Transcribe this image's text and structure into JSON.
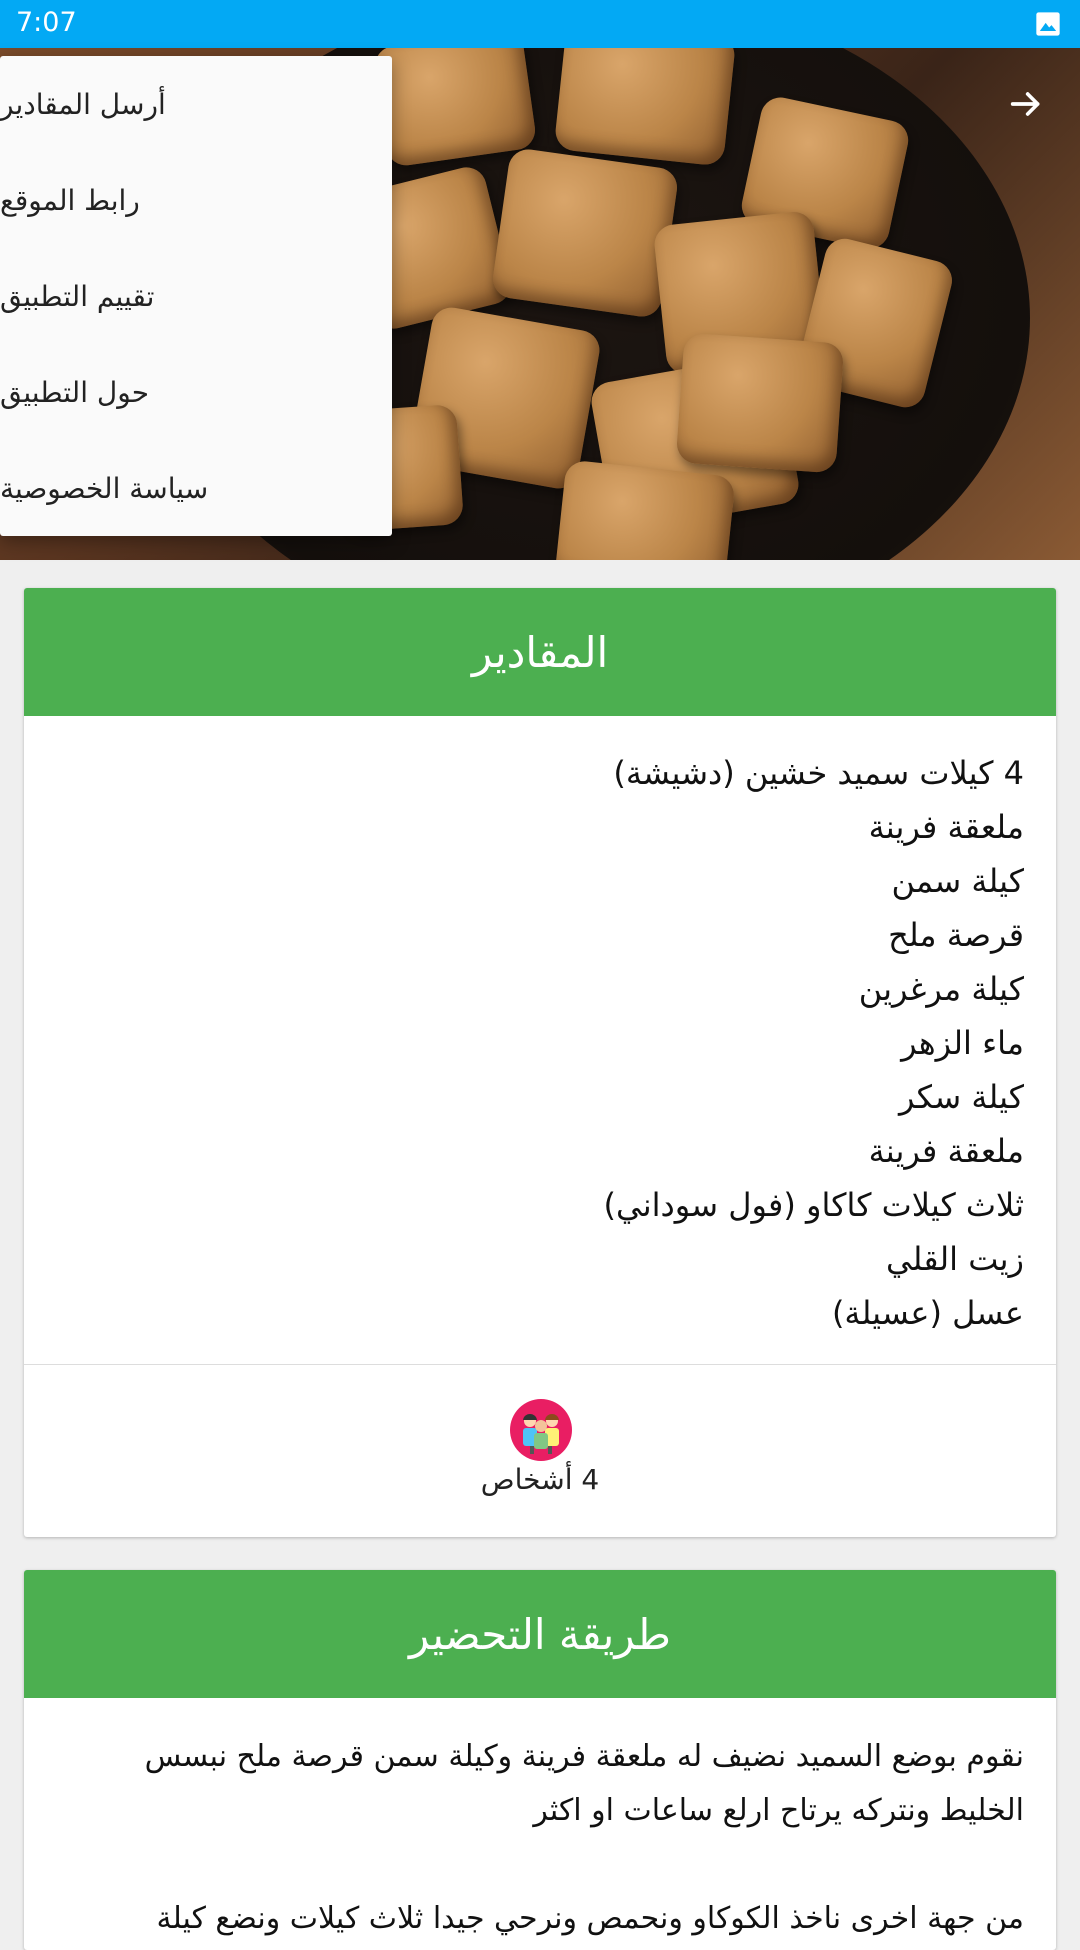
{
  "status_bar": {
    "time": "7:07"
  },
  "menu": {
    "items": [
      "أرسل المقادير",
      "رابط الموقع",
      "تقييم التطبيق",
      "حول التطبيق",
      "سياسة الخصوصية"
    ]
  },
  "ingredients": {
    "title": "المقادير",
    "items": [
      "4 كيلات سميد خشين (دشيشة)",
      "ملعقة فرينة",
      "كيلة سمن",
      "قرصة ملح",
      "كيلة مرغرين",
      "ماء الزهر",
      "كيلة سكر",
      "ملعقة فرينة",
      "ثلاث كيلات كاكاو (فول سوداني)",
      "زيت القلي",
      "عسل (عسيلة)"
    ],
    "servings": "4 أشخاص"
  },
  "method": {
    "title": "طريقة التحضير",
    "paragraphs": [
      "نقوم بوضع السميد نضيف له ملعقة فرينة وكيلة سمن قرصة ملح نبسس الخليط ونتركه يرتاح ارلع ساعات او اكثر",
      "من جهة اخرى ناخذ الكوكاو ونحمص ونرحي جيدا ثلاث كيلات ونضع كيلة"
    ]
  },
  "icons": {
    "status": "image-icon",
    "back": "arrow-right-icon",
    "servings": "people-icon"
  },
  "colors": {
    "status_bar": "#03a9f4",
    "header": "#4caf50",
    "servings_icon": "#e91e63"
  }
}
